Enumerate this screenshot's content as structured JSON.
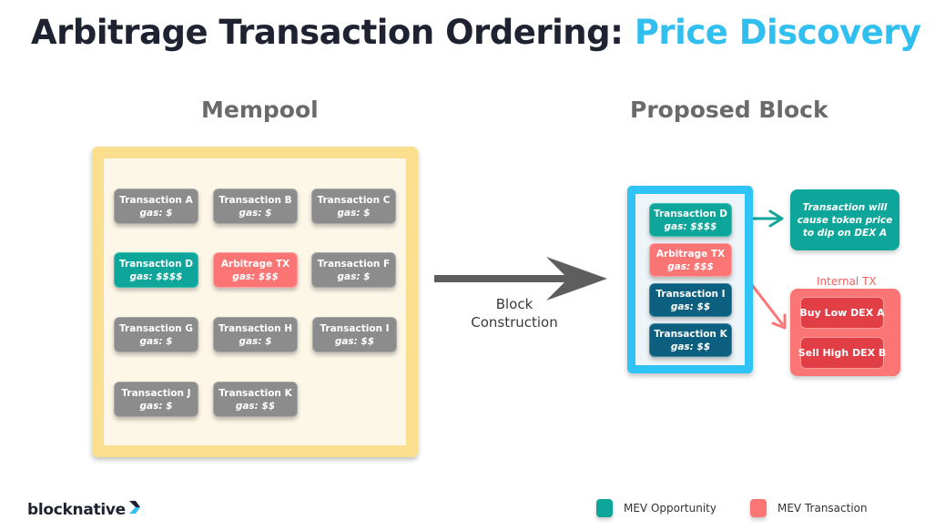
{
  "title": {
    "main": "Arbitrage Transaction Ordering:",
    "accent": "Price Discovery"
  },
  "colors": {
    "accent": "#31bff0",
    "mev_opportunity": "#0ea59a",
    "mev_transaction": "#fb7575",
    "mempool_border": "#fcdf8e",
    "block_border": "#30c3f5",
    "normal_tx": "#8c8c8c",
    "block_tx": "#0d5f7f"
  },
  "mempool": {
    "title": "Mempool",
    "transactions": [
      {
        "name": "Transaction A",
        "gas": "gas: $",
        "type": "normal"
      },
      {
        "name": "Transaction B",
        "gas": "gas: $",
        "type": "normal"
      },
      {
        "name": "Transaction C",
        "gas": "gas: $",
        "type": "normal"
      },
      {
        "name": "Transaction D",
        "gas": "gas: $$$$",
        "type": "mev-opportunity"
      },
      {
        "name": "Arbitrage TX",
        "gas": "gas: $$$",
        "type": "mev-transaction"
      },
      {
        "name": "Transaction F",
        "gas": "gas: $",
        "type": "normal"
      },
      {
        "name": "Transaction G",
        "gas": "gas: $",
        "type": "normal"
      },
      {
        "name": "Transaction H",
        "gas": "gas: $",
        "type": "normal"
      },
      {
        "name": "Transaction I",
        "gas": "gas: $$",
        "type": "normal"
      },
      {
        "name": "Transaction J",
        "gas": "gas: $",
        "type": "normal"
      },
      {
        "name": "Transaction K",
        "gas": "gas: $$",
        "type": "normal"
      }
    ]
  },
  "construction_label": {
    "line1": "Block",
    "line2": "Construction"
  },
  "proposed_block": {
    "title": "Proposed Block",
    "transactions": [
      {
        "name": "Transaction D",
        "gas": "gas: $$$$",
        "type": "mev-opportunity"
      },
      {
        "name": "Arbitrage TX",
        "gas": "gas: $$$",
        "type": "mev-transaction"
      },
      {
        "name": "Transaction I",
        "gas": "gas: $$",
        "type": "included"
      },
      {
        "name": "Transaction K",
        "gas": "gas: $$",
        "type": "included"
      }
    ]
  },
  "note": "Transaction will cause token price to dip on DEX A",
  "internal_tx": {
    "label": "Internal TX",
    "items": [
      "Buy Low DEX A",
      "Sell High DEX B"
    ]
  },
  "footer": {
    "logo": "blocknative",
    "legend": [
      {
        "label": "MEV Opportunity",
        "color": "#0ea59a"
      },
      {
        "label": "MEV Transaction",
        "color": "#fb7575"
      }
    ]
  }
}
